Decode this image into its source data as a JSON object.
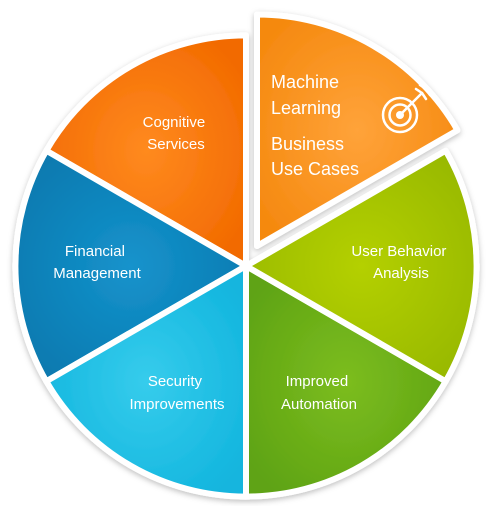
{
  "diagram": {
    "segments": [
      {
        "id": "machine-learning",
        "lines": [
          "Machine",
          "Learning"
        ],
        "lines2": [
          "Business",
          "Use Cases"
        ],
        "color": "#F7941D",
        "icon": "target-icon"
      },
      {
        "id": "user-behavior",
        "lines": [
          "User Behavior",
          "Analysis"
        ],
        "color": "#A8C400"
      },
      {
        "id": "improved-automation",
        "lines": [
          "Improved",
          "Automation"
        ],
        "color": "#72B31B"
      },
      {
        "id": "security-improvements",
        "lines": [
          "Security",
          "Improvements"
        ],
        "color": "#22C3E6"
      },
      {
        "id": "financial-management",
        "lines": [
          "Financial",
          "Management"
        ],
        "color": "#0A86C0"
      },
      {
        "id": "cognitive-services",
        "lines": [
          "Cognitive",
          "Services"
        ],
        "color": "#F56F00"
      }
    ]
  }
}
